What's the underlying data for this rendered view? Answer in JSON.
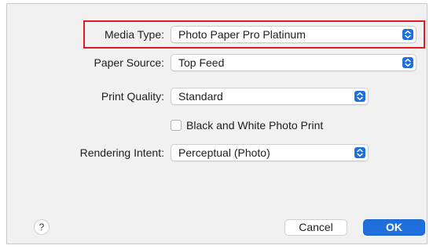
{
  "form": {
    "media_type": {
      "label": "Media Type:",
      "value": "Photo Paper Pro Platinum"
    },
    "paper_source": {
      "label": "Paper Source:",
      "value": "Top Feed"
    },
    "print_quality": {
      "label": "Print Quality:",
      "value": "Standard"
    },
    "bw_photo_print": {
      "label": "Black and White Photo Print",
      "checked": false
    },
    "rendering_intent": {
      "label": "Rendering Intent:",
      "value": "Perceptual (Photo)"
    }
  },
  "footer": {
    "help_label": "?",
    "cancel_label": "Cancel",
    "ok_label": "OK"
  },
  "colors": {
    "accent": "#1f6fdc",
    "highlight": "#e01b24",
    "background": "#f1f1f1"
  },
  "icons": {
    "popup_arrows": "chevron-up-down-icon",
    "help": "question-mark-icon"
  }
}
